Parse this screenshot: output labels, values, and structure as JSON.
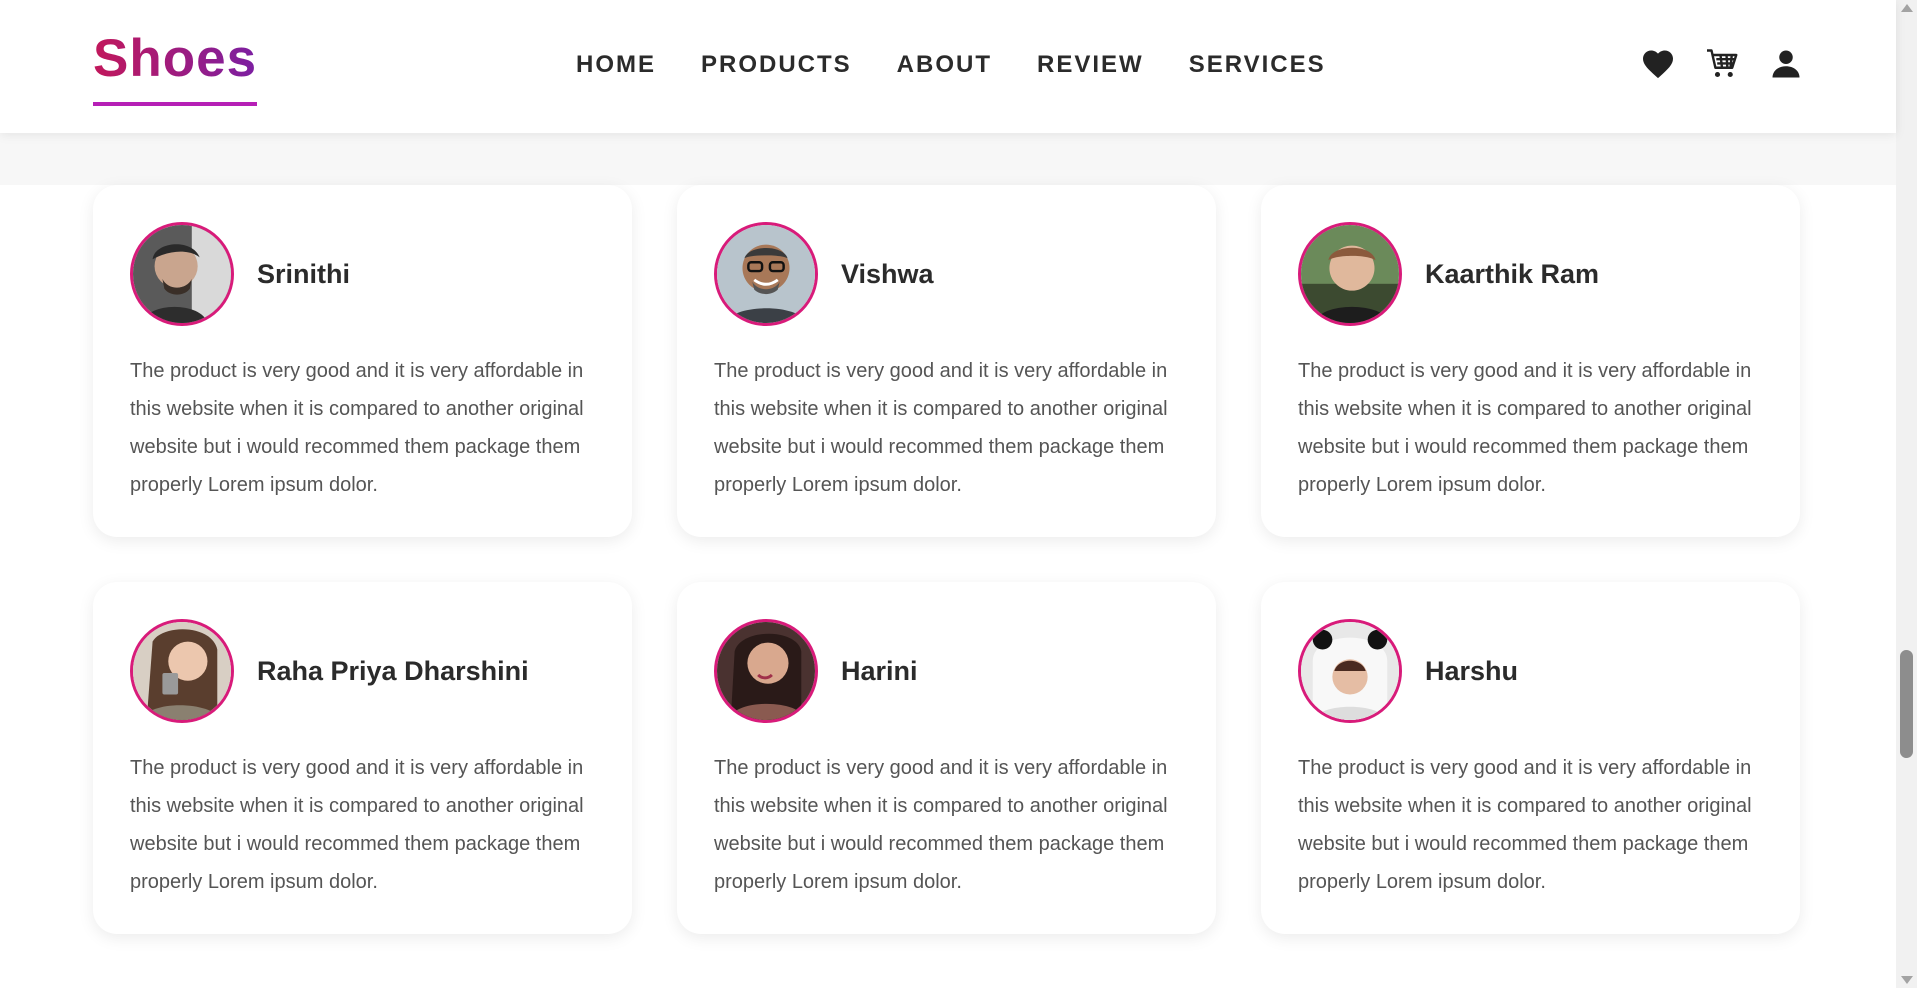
{
  "header": {
    "logo": "Shoes",
    "nav": [
      {
        "label": "HOME"
      },
      {
        "label": "PRODUCTS"
      },
      {
        "label": "ABOUT"
      },
      {
        "label": "REVIEW"
      },
      {
        "label": "SERVICES"
      }
    ],
    "icons": [
      "heart-icon",
      "cart-icon",
      "user-icon"
    ]
  },
  "colors": {
    "accent": "#d81b7a",
    "logo_gradient_start": "#c2185b",
    "logo_gradient_end": "#7b1fa2",
    "text_dark": "#2b2b2b",
    "text_body": "#555555"
  },
  "reviews": [
    {
      "name": "Srinithi",
      "text": "The product is very good and it is very affordable in this website when it is compared to another original website but i would recommed them package them properly Lorem ipsum dolor."
    },
    {
      "name": "Vishwa",
      "text": "The product is very good and it is very affordable in this website when it is compared to another original website but i would recommed them package them properly Lorem ipsum dolor."
    },
    {
      "name": "Kaarthik Ram",
      "text": "The product is very good and it is very affordable in this website when it is compared to another original website but i would recommed them package them properly Lorem ipsum dolor."
    },
    {
      "name": "Raha Priya Dharshini",
      "text": "The product is very good and it is very affordable in this website when it is compared to another original website but i would recommed them package them properly Lorem ipsum dolor."
    },
    {
      "name": "Harini",
      "text": "The product is very good and it is very affordable in this website when it is compared to another original website but i would recommed them package them properly Lorem ipsum dolor."
    },
    {
      "name": "Harshu",
      "text": "The product is very good and it is very affordable in this website when it is compared to another original website but i would recommed them package them properly Lorem ipsum dolor."
    }
  ]
}
